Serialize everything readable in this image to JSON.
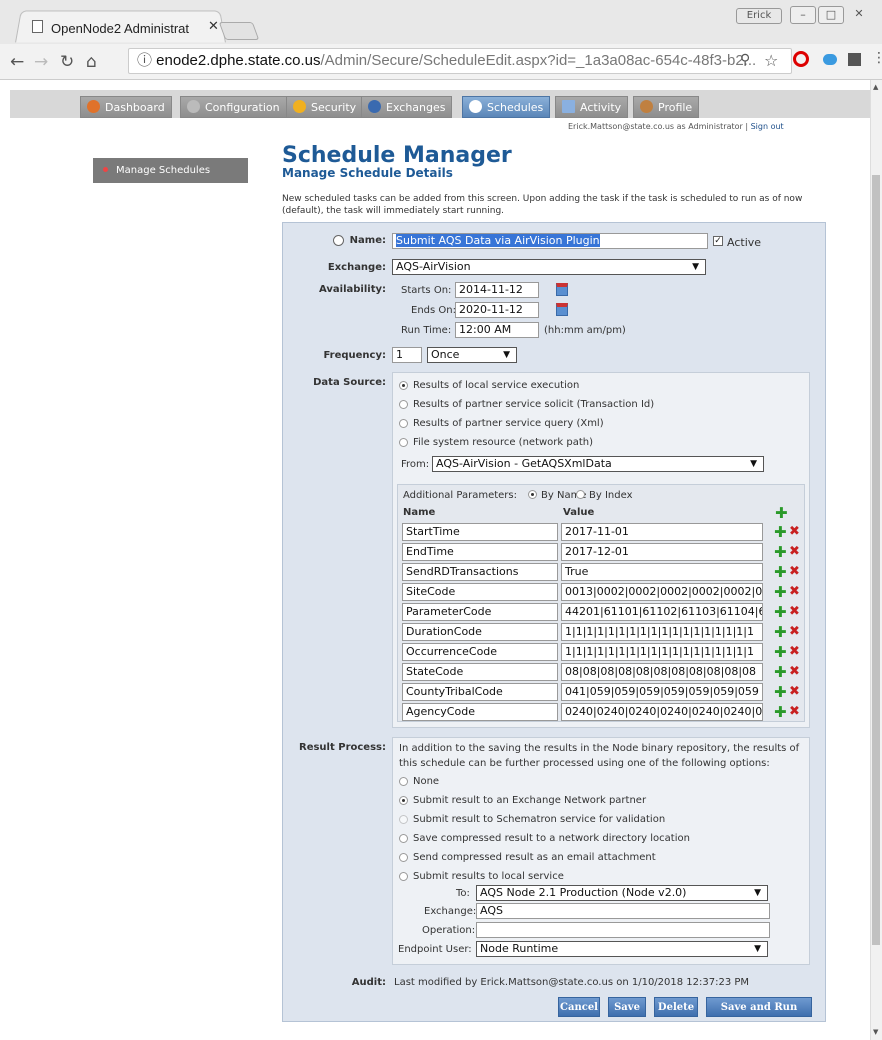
{
  "browser": {
    "tab_title": "OpenNode2 Administrat",
    "profile": "Erick",
    "url_host": "enode2.dphe.state.co.us",
    "url_path": "/Admin/Secure/ScheduleEdit.aspx?id=_1a3a08ac-654c-48f3-b2..."
  },
  "nav": {
    "tabs": [
      "Dashboard",
      "Configuration",
      "Security",
      "Exchanges",
      "Schedules",
      "Activity",
      "Profile"
    ],
    "active": "Schedules"
  },
  "userline": {
    "text": "Erick.Mattson@state.co.us as Administrator |",
    "signout": "Sign out"
  },
  "sidebar": {
    "item": "Manage Schedules"
  },
  "page": {
    "title": "Schedule Manager",
    "subtitle": "Manage Schedule Details",
    "intro": "New scheduled tasks can be added from this screen. Upon adding the task if the task is scheduled to run as of now (default), the task will immediately start running."
  },
  "form": {
    "name_label": "Name:",
    "name_value": "Submit AQS Data via AirVision Plugin",
    "active_label": "Active",
    "exchange_label": "Exchange:",
    "exchange_value": "AQS-AirVision",
    "availability_label": "Availability:",
    "starts_label": "Starts On:",
    "starts_value": "2014-11-12",
    "ends_label": "Ends On:",
    "ends_value": "2020-11-12",
    "runtime_label": "Run Time:",
    "runtime_value": "12:00 AM",
    "runtime_hint": "(hh:mm am/pm)",
    "frequency_label": "Frequency:",
    "frequency_value": "1",
    "frequency_unit": "Once",
    "datasource_label": "Data Source:",
    "ds_options": [
      "Results of local service execution",
      "Results of partner service solicit (Transaction Id)",
      "Results of partner service query (Xml)",
      "File system resource (network path)"
    ],
    "from_label": "From:",
    "from_value": "AQS-AirVision - GetAQSXmlData",
    "params_label": "Additional Parameters:",
    "by_name": "By Name",
    "by_index": "By Index",
    "col_name": "Name",
    "col_value": "Value",
    "params": [
      {
        "name": "StartTime",
        "value": "2017-11-01"
      },
      {
        "name": "EndTime",
        "value": "2017-12-01"
      },
      {
        "name": "SendRDTransactions",
        "value": "True"
      },
      {
        "name": "SiteCode",
        "value": "0013|0002|0002|0002|0002|0002|0"
      },
      {
        "name": "ParameterCode",
        "value": "44201|61101|61102|61103|61104|6"
      },
      {
        "name": "DurationCode",
        "value": "1|1|1|1|1|1|1|1|1|1|1|1|1|1|1|1|1|1"
      },
      {
        "name": "OccurrenceCode",
        "value": "1|1|1|1|1|1|1|1|1|1|1|1|1|1|1|1|1|1"
      },
      {
        "name": "StateCode",
        "value": "08|08|08|08|08|08|08|08|08|08|08"
      },
      {
        "name": "CountyTribalCode",
        "value": "041|059|059|059|059|059|059|059"
      },
      {
        "name": "AgencyCode",
        "value": "0240|0240|0240|0240|0240|0240|0"
      }
    ],
    "result_label": "Result Process:",
    "result_intro": "In addition to the saving the results in the Node binary repository, the results of this schedule can be further processed using one of the following options:",
    "result_options": [
      "None",
      "Submit result to an Exchange Network partner",
      "Submit result to Schematron service for validation",
      "Save compressed result to a network directory location",
      "Send compressed result as an email attachment",
      "Submit results to local service"
    ],
    "to_label": "To:",
    "to_value": "AQS Node 2.1 Production (Node v2.0)",
    "rp_exchange_label": "Exchange:",
    "rp_exchange_value": "AQS",
    "operation_label": "Operation:",
    "operation_value": "",
    "endpoint_label": "Endpoint User:",
    "endpoint_value": "Node Runtime",
    "audit_label": "Audit:",
    "audit_value": "Last modified by Erick.Mattson@state.co.us on 1/10/2018 12:37:23 PM"
  },
  "buttons": {
    "cancel": "Cancel",
    "save": "Save",
    "delete": "Delete",
    "save_run": "Save and Run Now"
  },
  "colors": {
    "title": "#1e5a96",
    "panel": "#dde4ee",
    "button": "#4f7fbf",
    "active_tab": "#6a96c8"
  }
}
